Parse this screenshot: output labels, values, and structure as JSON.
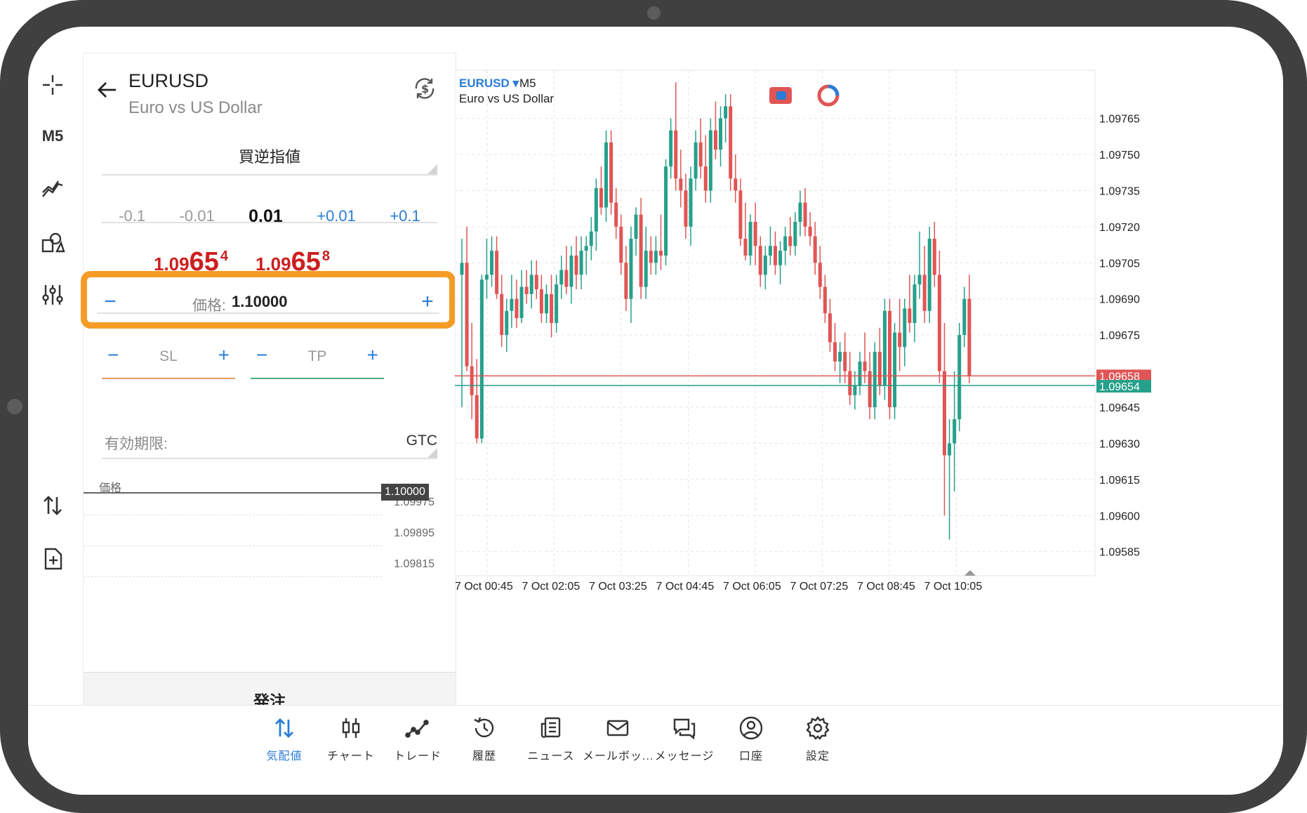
{
  "toolbar": {
    "timeframe": "M5"
  },
  "order_panel": {
    "symbol": "EURUSD",
    "symbol_desc": "Euro vs US Dollar",
    "order_type": "買逆指値",
    "volume_steps": [
      "-0.1",
      "-0.01",
      "0.01",
      "+0.01",
      "+0.1"
    ],
    "bid": {
      "a": "1.09",
      "b": "65",
      "c": "4"
    },
    "ask": {
      "a": "1.09",
      "b": "65",
      "c": "8"
    },
    "price_label": "価格:",
    "price_value": "1.10000",
    "minus": "−",
    "plus": "+",
    "sl_label": "SL",
    "tp_label": "TP",
    "expiry_label": "有効期限:",
    "expiry_value": "GTC",
    "mini_chart": {
      "label": "価格",
      "current": "1.10000",
      "ticks": [
        "1.09975",
        "1.09895",
        "1.09815"
      ]
    },
    "submit": "発注"
  },
  "chart_data": {
    "type": "candlestick",
    "symbol": "EURUSD",
    "timeframe": "M5",
    "description": "Euro vs US Dollar",
    "y_ticks": [
      "1.09765",
      "1.09750",
      "1.09735",
      "1.09720",
      "1.09705",
      "1.09690",
      "1.09675",
      "1.09645",
      "1.09630",
      "1.09615",
      "1.09600",
      "1.09585"
    ],
    "ylim": [
      1.09575,
      1.09785
    ],
    "x_ticks": [
      "7 Oct 00:45",
      "7 Oct 02:05",
      "7 Oct 03:25",
      "7 Oct 04:45",
      "7 Oct 06:05",
      "7 Oct 07:25",
      "7 Oct 08:45",
      "7 Oct 10:05"
    ],
    "ask_line": {
      "value": "1.09658",
      "color": "#e05555"
    },
    "bid_line": {
      "value": "1.09654",
      "color": "#26a08a"
    },
    "up_color": "#26a08a",
    "down_color": "#e05555",
    "candles": [
      [
        1.097,
        1.09715,
        1.09645,
        1.09705
      ],
      [
        1.09705,
        1.0972,
        1.0966,
        1.09662
      ],
      [
        1.09662,
        1.0968,
        1.0964,
        1.0965
      ],
      [
        1.0965,
        1.09665,
        1.0963,
        1.09632
      ],
      [
        1.09632,
        1.097,
        1.0963,
        1.09698
      ],
      [
        1.09698,
        1.09715,
        1.0969,
        1.097
      ],
      [
        1.097,
        1.09716,
        1.09695,
        1.0971
      ],
      [
        1.0971,
        1.09716,
        1.0969,
        1.09692
      ],
      [
        1.09692,
        1.097,
        1.0967,
        1.09675
      ],
      [
        1.09675,
        1.0969,
        1.09668,
        1.09685
      ],
      [
        1.09685,
        1.097,
        1.09678,
        1.0969
      ],
      [
        1.0969,
        1.09698,
        1.09678,
        1.09682
      ],
      [
        1.09682,
        1.09702,
        1.0968,
        1.09695
      ],
      [
        1.09695,
        1.09702,
        1.09688,
        1.09692
      ],
      [
        1.09692,
        1.09706,
        1.09686,
        1.097
      ],
      [
        1.097,
        1.09706,
        1.0969,
        1.09694
      ],
      [
        1.09694,
        1.097,
        1.0968,
        1.09684
      ],
      [
        1.09684,
        1.09696,
        1.0968,
        1.09692
      ],
      [
        1.09692,
        1.097,
        1.09674,
        1.0968
      ],
      [
        1.0968,
        1.097,
        1.09676,
        1.09696
      ],
      [
        1.09696,
        1.09708,
        1.0969,
        1.09702
      ],
      [
        1.09702,
        1.09712,
        1.09692,
        1.09695
      ],
      [
        1.09695,
        1.09712,
        1.09688,
        1.09708
      ],
      [
        1.09708,
        1.09716,
        1.09694,
        1.097
      ],
      [
        1.097,
        1.09716,
        1.09694,
        1.0971
      ],
      [
        1.0971,
        1.09716,
        1.097,
        1.09712
      ],
      [
        1.09712,
        1.09724,
        1.09706,
        1.09718
      ],
      [
        1.09718,
        1.0974,
        1.0971,
        1.09736
      ],
      [
        1.09736,
        1.09745,
        1.09725,
        1.09728
      ],
      [
        1.09728,
        1.0976,
        1.09722,
        1.09755
      ],
      [
        1.09755,
        1.0976,
        1.09725,
        1.0973
      ],
      [
        1.0973,
        1.09736,
        1.09715,
        1.0972
      ],
      [
        1.0972,
        1.09725,
        1.097,
        1.09705
      ],
      [
        1.09705,
        1.09712,
        1.09685,
        1.0969
      ],
      [
        1.0969,
        1.0972,
        1.0968,
        1.09715
      ],
      [
        1.09715,
        1.09728,
        1.09708,
        1.09725
      ],
      [
        1.09725,
        1.09732,
        1.0969,
        1.09695
      ],
      [
        1.09695,
        1.0972,
        1.0969,
        1.0971
      ],
      [
        1.0971,
        1.09716,
        1.097,
        1.09705
      ],
      [
        1.09705,
        1.09716,
        1.097,
        1.0971
      ],
      [
        1.0971,
        1.09725,
        1.09702,
        1.09708
      ],
      [
        1.09708,
        1.09748,
        1.09704,
        1.09745
      ],
      [
        1.09745,
        1.09765,
        1.0974,
        1.0976
      ],
      [
        1.0976,
        1.0978,
        1.09735,
        1.0974
      ],
      [
        1.0974,
        1.09752,
        1.09728,
        1.09735
      ],
      [
        1.09735,
        1.09742,
        1.09715,
        1.0972
      ],
      [
        1.0972,
        1.09745,
        1.09712,
        1.0974
      ],
      [
        1.0974,
        1.0976,
        1.09735,
        1.09755
      ],
      [
        1.09755,
        1.09765,
        1.0974,
        1.09745
      ],
      [
        1.09745,
        1.09758,
        1.0973,
        1.09735
      ],
      [
        1.09735,
        1.09765,
        1.0973,
        1.0976
      ],
      [
        1.0976,
        1.09772,
        1.09748,
        1.09752
      ],
      [
        1.09752,
        1.0977,
        1.09745,
        1.09765
      ],
      [
        1.09765,
        1.09775,
        1.09755,
        1.0977
      ],
      [
        1.0977,
        1.09775,
        1.09735,
        1.0974
      ],
      [
        1.0974,
        1.0975,
        1.0973,
        1.09735
      ],
      [
        1.09735,
        1.0974,
        1.09712,
        1.09715
      ],
      [
        1.09715,
        1.0973,
        1.09706,
        1.09708
      ],
      [
        1.09708,
        1.09725,
        1.09704,
        1.09722
      ],
      [
        1.09722,
        1.0973,
        1.09704,
        1.09712
      ],
      [
        1.09712,
        1.09716,
        1.09695,
        1.097
      ],
      [
        1.097,
        1.09712,
        1.09694,
        1.09708
      ],
      [
        1.09708,
        1.0972,
        1.09704,
        1.09712
      ],
      [
        1.09712,
        1.09718,
        1.097,
        1.09704
      ],
      [
        1.09704,
        1.09714,
        1.09696,
        1.0971
      ],
      [
        1.0971,
        1.0972,
        1.09704,
        1.09716
      ],
      [
        1.09716,
        1.09724,
        1.09708,
        1.09712
      ],
      [
        1.09712,
        1.09726,
        1.09708,
        1.09722
      ],
      [
        1.09722,
        1.09735,
        1.09716,
        1.0973
      ],
      [
        1.0973,
        1.09736,
        1.09716,
        1.0972
      ],
      [
        1.0972,
        1.09726,
        1.09712,
        1.09716
      ],
      [
        1.09716,
        1.09722,
        1.097,
        1.09705
      ],
      [
        1.09705,
        1.09712,
        1.0969,
        1.09695
      ],
      [
        1.09695,
        1.097,
        1.0968,
        1.09684
      ],
      [
        1.09684,
        1.0969,
        1.09668,
        1.09672
      ],
      [
        1.09672,
        1.0968,
        1.0966,
        1.09664
      ],
      [
        1.09664,
        1.09672,
        1.09655,
        1.09668
      ],
      [
        1.09668,
        1.09676,
        1.09655,
        1.0966
      ],
      [
        1.0966,
        1.09668,
        1.09646,
        1.0965
      ],
      [
        1.0965,
        1.0966,
        1.09644,
        1.09654
      ],
      [
        1.09654,
        1.09668,
        1.0965,
        1.09664
      ],
      [
        1.09664,
        1.09676,
        1.09655,
        1.0966
      ],
      [
        1.0966,
        1.09668,
        1.0964,
        1.09645
      ],
      [
        1.09645,
        1.09672,
        1.0964,
        1.09668
      ],
      [
        1.09668,
        1.09678,
        1.0965,
        1.09654
      ],
      [
        1.09654,
        1.0969,
        1.09648,
        1.09685
      ],
      [
        1.09685,
        1.0969,
        1.0964,
        1.09645
      ],
      [
        1.09645,
        1.0968,
        1.0964,
        1.09676
      ],
      [
        1.09676,
        1.0969,
        1.0966,
        1.0967
      ],
      [
        1.0967,
        1.0969,
        1.09662,
        1.09686
      ],
      [
        1.09686,
        1.097,
        1.09676,
        1.0968
      ],
      [
        1.0968,
        1.097,
        1.09672,
        1.09696
      ],
      [
        1.09696,
        1.09718,
        1.0969,
        1.097
      ],
      [
        1.097,
        1.09712,
        1.0968,
        1.09685
      ],
      [
        1.09685,
        1.0972,
        1.0968,
        1.09715
      ],
      [
        1.09715,
        1.09722,
        1.09695,
        1.097
      ],
      [
        1.097,
        1.0971,
        1.09655,
        1.0966
      ],
      [
        1.0966,
        1.0968,
        1.096,
        1.09625
      ],
      [
        1.09625,
        1.0964,
        1.0959,
        1.0963
      ],
      [
        1.0963,
        1.0966,
        1.0961,
        1.0964
      ],
      [
        1.0964,
        1.0968,
        1.09635,
        1.09675
      ],
      [
        1.09675,
        1.09695,
        1.0967,
        1.0969
      ],
      [
        1.0969,
        1.097,
        1.09655,
        1.09658
      ]
    ]
  },
  "nav": [
    {
      "label": "気配値",
      "icon": "quotes-icon",
      "active": true
    },
    {
      "label": "チャート",
      "icon": "candles-icon",
      "active": false
    },
    {
      "label": "トレード",
      "icon": "trade-icon",
      "active": false
    },
    {
      "label": "履歴",
      "icon": "history-icon",
      "active": false
    },
    {
      "label": "ニュース",
      "icon": "news-icon",
      "active": false
    },
    {
      "label": "メールボッ...",
      "icon": "mail-icon",
      "active": false
    },
    {
      "label": "メッセージ",
      "icon": "messages-icon",
      "active": false
    },
    {
      "label": "口座",
      "icon": "account-icon",
      "active": false
    },
    {
      "label": "設定",
      "icon": "settings-icon",
      "active": false
    }
  ],
  "colors": {
    "accent": "#2a7cd8",
    "highlight": "#f59c26",
    "price_red": "#cc1f1f"
  }
}
